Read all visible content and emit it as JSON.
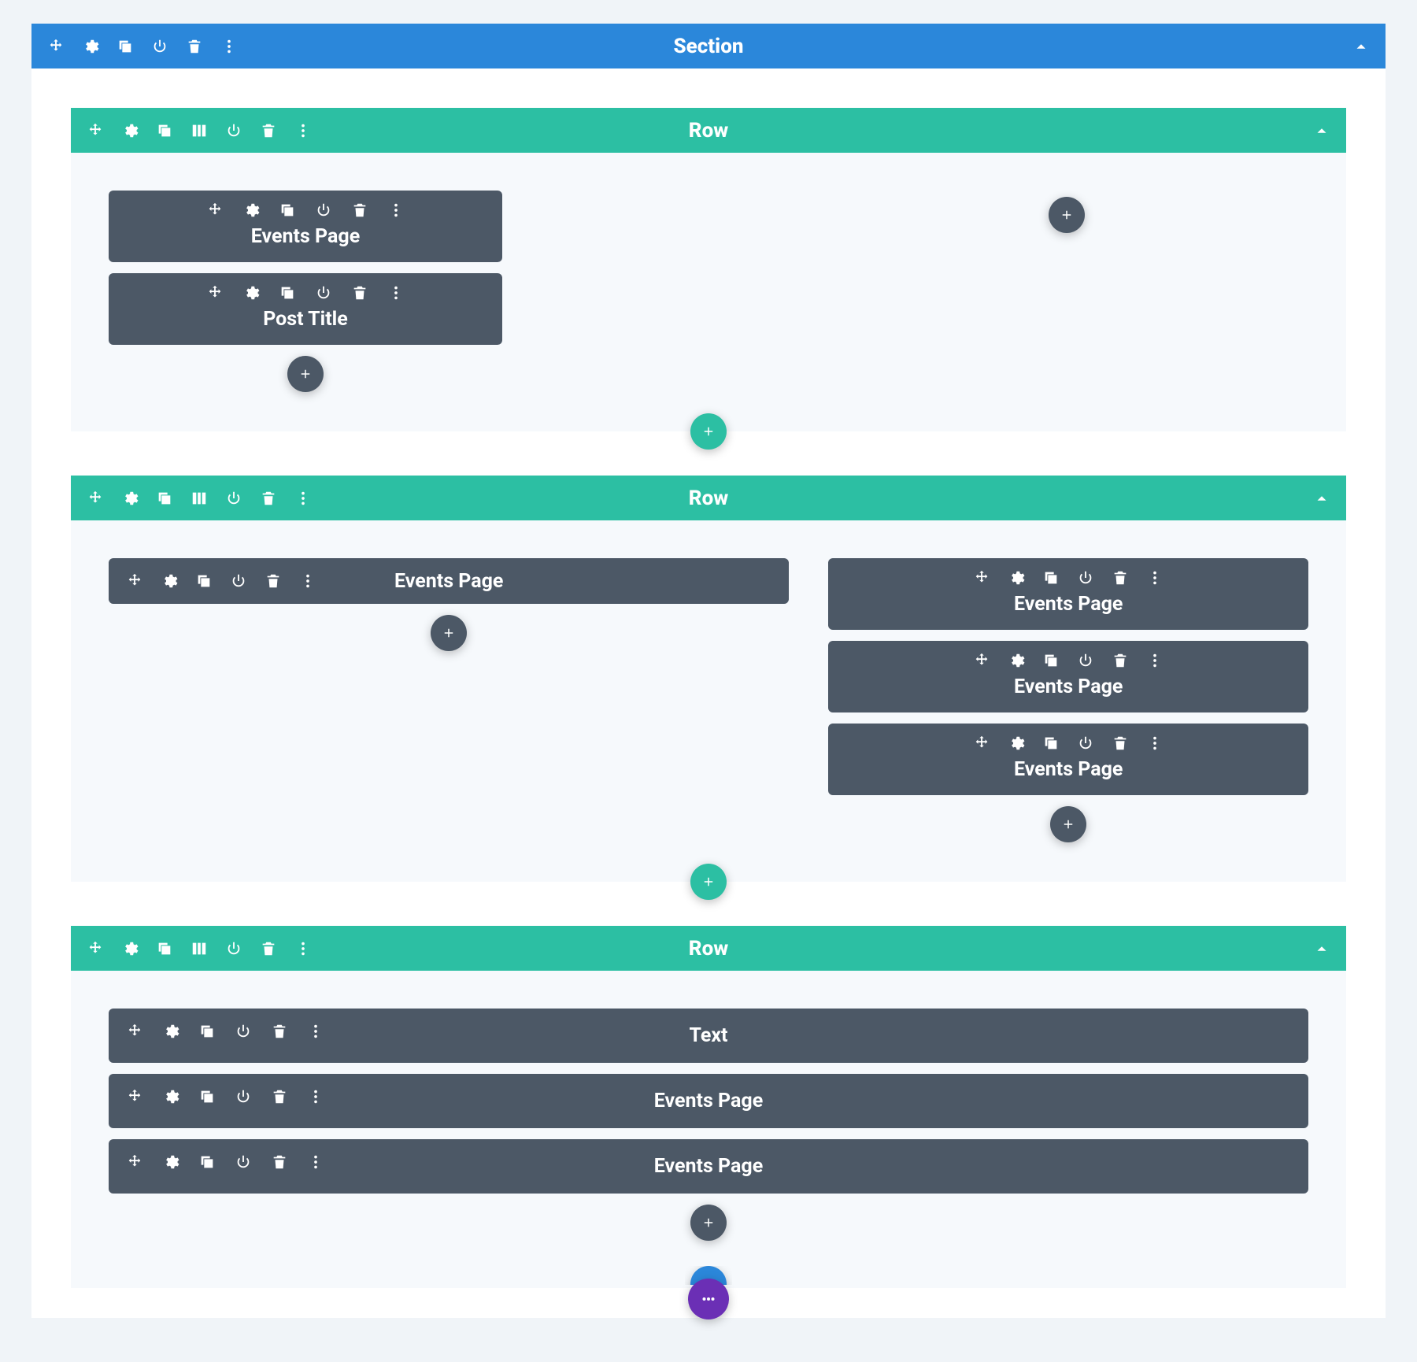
{
  "colors": {
    "section": "#2b87da",
    "row": "#2cbfa3",
    "module": "#4c5866",
    "purple": "#6b2fb5"
  },
  "icons": {
    "move": "move-icon",
    "gear": "gear-icon",
    "duplicate": "duplicate-icon",
    "columns": "columns-icon",
    "power": "power-icon",
    "trash": "trash-icon",
    "more": "more-icon",
    "caret_up": "chevron-up-icon",
    "plus": "plus-icon",
    "dots": "dots-icon"
  },
  "section": {
    "title": "Section",
    "rows": [
      {
        "title": "Row",
        "layout": "two-col-narrow-left",
        "columns": [
          {
            "modules": [
              {
                "label": "Events Page"
              },
              {
                "label": "Post Title"
              }
            ]
          },
          {
            "modules": []
          }
        ]
      },
      {
        "title": "Row",
        "layout": "two-col-wide-left",
        "columns": [
          {
            "modules": [
              {
                "label": "Events Page"
              }
            ]
          },
          {
            "modules": [
              {
                "label": "Events Page"
              },
              {
                "label": "Events Page"
              },
              {
                "label": "Events Page"
              }
            ]
          }
        ]
      },
      {
        "title": "Row",
        "layout": "one-col",
        "columns": [
          {
            "modules": [
              {
                "label": "Text"
              },
              {
                "label": "Events Page"
              },
              {
                "label": "Events Page"
              }
            ]
          }
        ]
      }
    ]
  }
}
